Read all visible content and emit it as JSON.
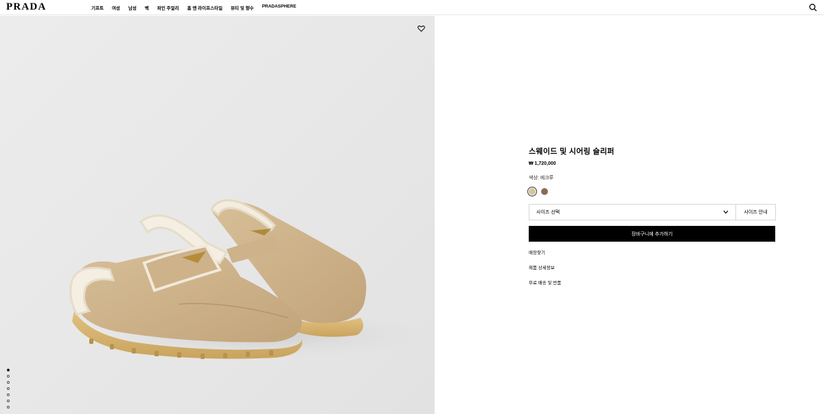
{
  "brand": {
    "logo": "PRADA"
  },
  "nav": {
    "items": [
      "기프트",
      "여성",
      "남성",
      "백",
      "파인 주얼리",
      "홈 앤 라이프스타일",
      "뷰티 및 향수",
      "PRADASPHERE"
    ]
  },
  "icons": {
    "search": "search-icon",
    "heart": "heart-icon",
    "chevron": "chevron-down-icon"
  },
  "gallery": {
    "slide_count": 7,
    "active_slide": 1
  },
  "product": {
    "title": "스웨이드 및 시어링 슬리퍼",
    "price": "₩ 1,720,000",
    "color_label": "색상: 에크루",
    "swatches": [
      {
        "name": "ecru",
        "color": "#d8c3a0",
        "selected": true
      },
      {
        "name": "brown",
        "color": "#8b6c55",
        "selected": false
      }
    ],
    "size_select_label": "사이즈 선택",
    "size_guide_label": "사이즈 안내",
    "add_to_cart_label": "장바구니에 추가하기",
    "links": [
      "매장찾기",
      "제품 상세정보",
      "무료 배송 및 반품"
    ]
  },
  "colors": {
    "accent": "#000000",
    "background_image": "#e9e9e9"
  }
}
